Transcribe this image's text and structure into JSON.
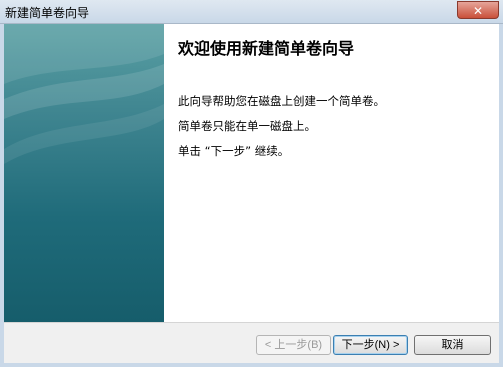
{
  "window": {
    "title": "新建简单卷向导",
    "close_label": "✕"
  },
  "main": {
    "heading": "欢迎使用新建简单卷向导",
    "paragraphs": [
      "此向导帮助您在磁盘上创建一个简单卷。",
      "简单卷只能在单一磁盘上。",
      "单击 “下一步” 继续。"
    ]
  },
  "footer": {
    "back_label": "< 上一步(B)",
    "next_label": "下一步(N) >",
    "cancel_label": "取消"
  },
  "colors": {
    "panel_top": "#5aa0a4",
    "panel_bottom": "#165d6b"
  }
}
